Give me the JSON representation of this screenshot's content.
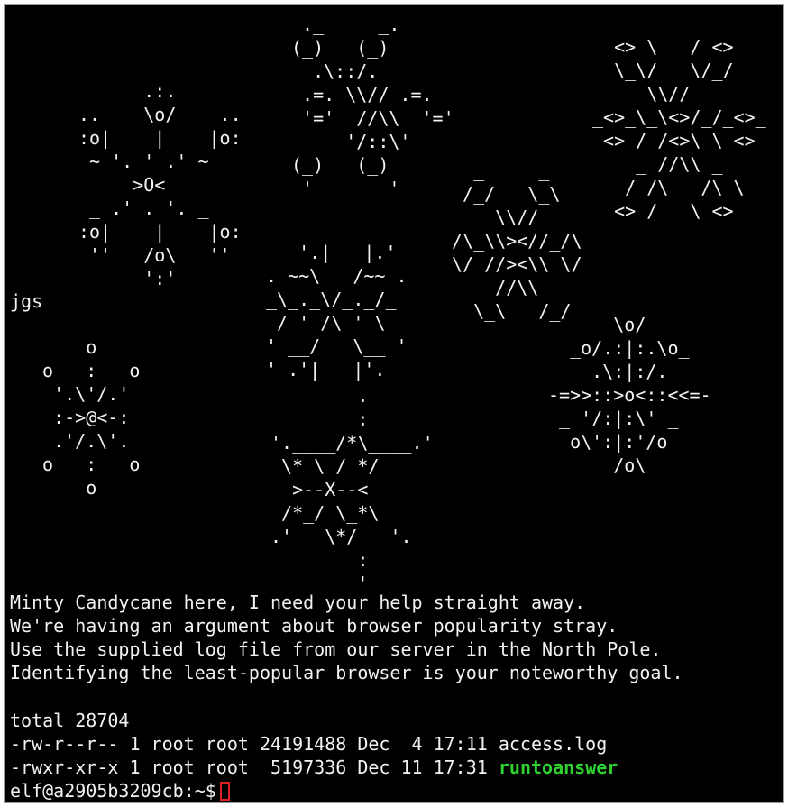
{
  "art": {
    "flake_top_left": "      .:.\n..    \\o/    ..\n:o|    |    |o:\n ~ '. ' .' ~\n     >O<\n _ .' . '. _\n:o|    |    |o:\n ''   /o\\   ''\n      ':'",
    "flake_top_center": " ._     _.\n(_)   (_)\n  .\\::/.\n_.=._\\\\//_.=._\n '='  //\\\\  '='\n     '/::\\'\n(_)   (_)\n '       '",
    "flake_top_right": "  <> \\   / <>\n  \\_\\/   \\/_/\n     \\\\//\n_<>_\\_\\<>/_/_<>_\n <> / /<>\\ \\ <>\n    _ //\\\\ _\n   / /\\   /\\ \\\n  <> /   \\ <>",
    "flake_mid_center": "  _     _\n /_/   \\_\\\n    \\\\//\n/\\_\\\\><//_/\\\n\\/ //><\\\\ \\/\n   _//\\\\_\n  \\_\\   /_/",
    "flake_center_left": "   '.|   |.'\n. ~~\\   /~~ .\n_\\_._\\/_._/_\n / ' /\\ ' \\\n' __/   \\__ '\n' .'|   |'.",
    "signature": "jgs",
    "flake_bottom_left": "     o\n o   :   o\n  '.\\'/.'\n  :->@<-:\n  .'/.\\'.\n o   :   o\n     o",
    "flake_bottom_center": "        .\n        :\n'.____/*\\____.'\n \\* \\ / */\n  >--X--<\n /*_/ \\_*\\\n.'   \\*/   '.\n        :\n        '",
    "flake_bottom_right": "      \\o/\n  _o/.:|:.\\o_\n    .\\:|:/.\n-=>>::>o<::<<=-\n _ '/:|:\\' _\n  o\\':|:'/o\n      /o\\"
  },
  "message": [
    "Minty Candycane here, I need your help straight away.",
    "We're having an argument about browser popularity stray.",
    "Use the supplied log file from our server in the North Pole.",
    "Identifying the least-popular browser is your noteworthy goal."
  ],
  "listing": {
    "total": "total 28704",
    "row1": "-rw-r--r-- 1 root root 24191488 Dec  4 17:11 access.log",
    "row2_prefix": "-rwxr-xr-x 1 root root  5197336 Dec 11 17:31 ",
    "row2_name": "runtoanswer"
  },
  "prompt": {
    "text": "elf@a2905b3209cb:~$",
    "cursor_color": "#e02020"
  },
  "colors": {
    "background": "#000000",
    "foreground": "#f2f2f2",
    "executable": "#2fd12f"
  }
}
